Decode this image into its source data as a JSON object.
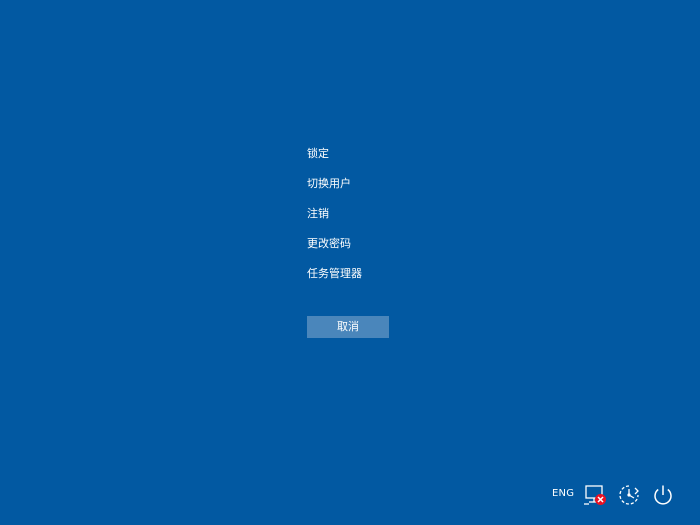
{
  "menu": {
    "items": [
      {
        "label": "锁定"
      },
      {
        "label": "切换用户"
      },
      {
        "label": "注销"
      },
      {
        "label": "更改密码"
      },
      {
        "label": "任务管理器"
      }
    ]
  },
  "cancel": {
    "label": "取消"
  },
  "tray": {
    "language": "ENG",
    "icons": [
      "network-disconnected-icon",
      "ease-of-access-icon",
      "power-icon"
    ]
  },
  "colors": {
    "background": "#0259a2",
    "button": "#4a86bb",
    "error": "#e81123",
    "text": "#ffffff"
  }
}
